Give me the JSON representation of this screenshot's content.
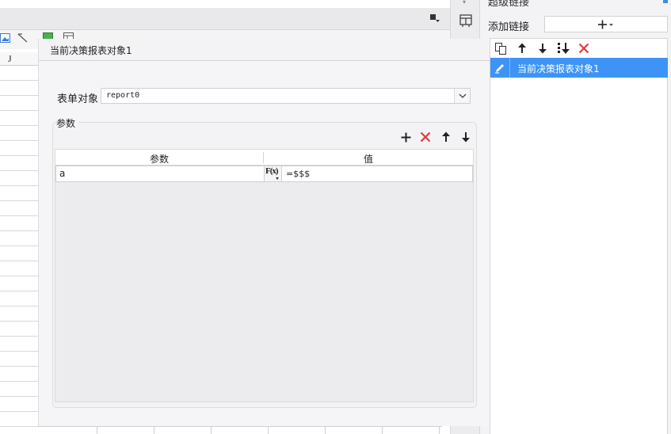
{
  "spreadsheet": {
    "column_label": "J",
    "row_count": 24
  },
  "right_panel": {
    "title": "超级链接",
    "add_link_label": "添加链接",
    "toolbar_icons": [
      "copy-icon",
      "arrow-up-icon",
      "arrow-down-icon",
      "sort-icon",
      "delete-icon"
    ],
    "links": [
      {
        "label": "当前决策报表对象1",
        "selected": true
      }
    ]
  },
  "dialog": {
    "title": "当前决策报表对象1",
    "form_object_label": "表单对象",
    "form_object_value": "report0",
    "params_group_label": "参数",
    "params_table": {
      "headers": [
        "参数",
        "值"
      ],
      "rows": [
        {
          "name": "a",
          "formula_label": "F(x)",
          "value": "=$$$"
        }
      ]
    }
  },
  "colors": {
    "selection_blue": "#3d94f6",
    "delete_red": "#e23b3b",
    "dialog_bg": "#f5f5f7"
  }
}
